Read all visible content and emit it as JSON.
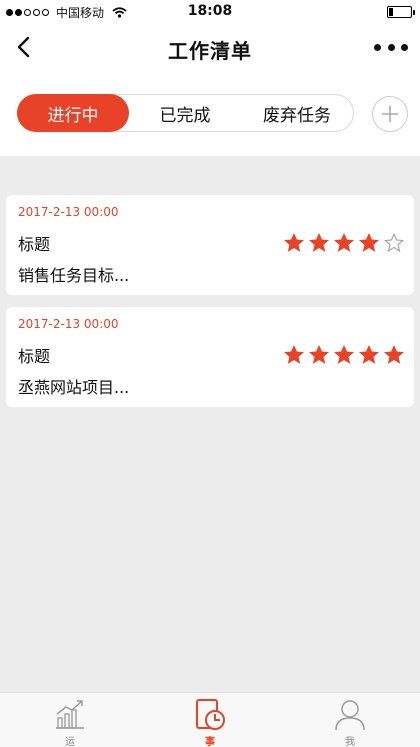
{
  "status": {
    "carrier": "中国移动",
    "time": "18:08"
  },
  "nav": {
    "title": "工作清单"
  },
  "tabs": {
    "items": [
      "进行中",
      "已完成",
      "废弃任务"
    ],
    "active": 0
  },
  "tasks": [
    {
      "date": "2017-2-13 00:00",
      "title": "标题",
      "desc": "销售任务目标...",
      "rating": 4
    },
    {
      "date": "2017-2-13 00:00",
      "title": "标题",
      "desc": "丞燕网站项目...",
      "rating": 5
    }
  ],
  "tabbar": {
    "items": [
      "运",
      "事",
      "我"
    ],
    "active": 1
  },
  "colors": {
    "accent": "#e84228",
    "background": "#ececec"
  }
}
